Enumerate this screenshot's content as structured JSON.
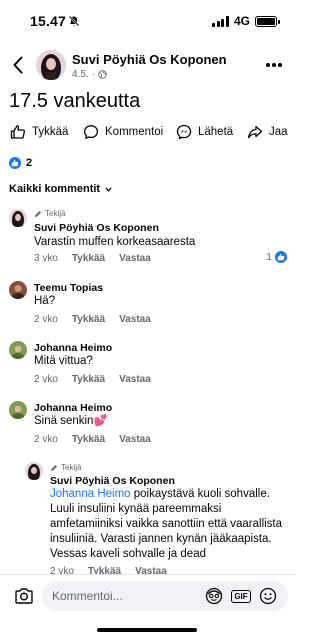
{
  "status": {
    "time": "15.47",
    "network": "4G"
  },
  "header": {
    "author": "Suvi Pöyhiä Os Koponen",
    "date": "4.5."
  },
  "post": {
    "text": "17.5 vankeutta"
  },
  "actions": {
    "like": "Tykkää",
    "comment": "Kommentoi",
    "send": "Lähetä",
    "share": "Jaa"
  },
  "reactions": {
    "count": "2"
  },
  "sort": {
    "label": "Kaikki kommentit"
  },
  "comments": [
    {
      "badge": "Tekijä",
      "author": "Suvi Pöyhiä Os Koponen",
      "text": "Varastin muffen korkeasaaresta",
      "time": "3 vko",
      "like": "Tykkää",
      "reply": "Vastaa",
      "likes": "1"
    },
    {
      "author": "Teemu Topias",
      "text": "Hä?",
      "time": "2 vko",
      "like": "Tykkää",
      "reply": "Vastaa"
    },
    {
      "author": "Johanna Heimo",
      "text": "Mitä vittua?",
      "time": "2 vko",
      "like": "Tykkää",
      "reply": "Vastaa"
    },
    {
      "author": "Johanna Heimo",
      "text": "Sinä senkin",
      "time": "2 vko",
      "like": "Tykkää",
      "reply": "Vastaa"
    },
    {
      "badge": "Tekijä",
      "author": "Suvi Pöyhiä Os Koponen",
      "mention": "Johanna Heimo",
      "text_lines": [
        " poikaystävä kuoli sohvalle.",
        "Luuli insuliini kynää pareemmaksi",
        "amfetamiiniksi vaikka sanottiin että vaarallista",
        "insuliiniä. Varasti jannen kynän jääkaapista.",
        "Vessas kaveli sohvalle ja dead"
      ],
      "time": "2 vko",
      "like": "Tykkää",
      "reply": "Vastaa"
    }
  ],
  "composer": {
    "placeholder": "Kommentoi..."
  }
}
